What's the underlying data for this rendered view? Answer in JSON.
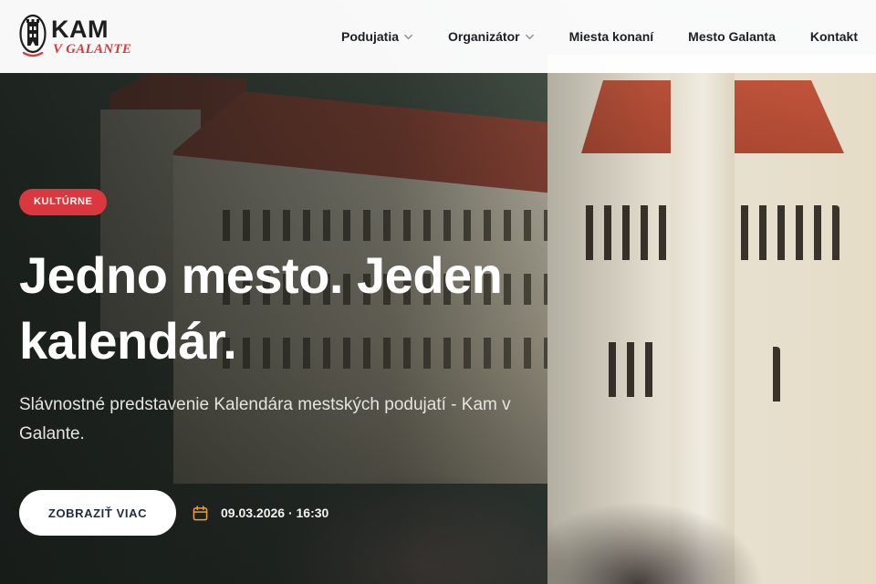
{
  "brand": {
    "name": "KAM",
    "tagline": "V GALANTE",
    "accent_color": "#d83a3d",
    "icon": "castle-tower-logo-icon"
  },
  "nav": {
    "items": [
      {
        "label": "Podujatia",
        "has_dropdown": true
      },
      {
        "label": "Organizátor",
        "has_dropdown": true
      },
      {
        "label": "Miesta konaní",
        "has_dropdown": false
      },
      {
        "label": "Mesto Galanta",
        "has_dropdown": false
      },
      {
        "label": "Kontakt",
        "has_dropdown": false
      }
    ]
  },
  "hero": {
    "badge": "KULTÚRNE",
    "badge_color": "#d9383e",
    "title_line1": "Jedno mesto. Jeden",
    "title_line2": "kalendár.",
    "subtitle": "Slávnostné predstavenie Kalendára mestských podujatí - Kam v Galante.",
    "cta_label": "ZOBRAZIŤ VIAC",
    "date": "09.03.2026 · 16:30",
    "date_icon": "calendar-icon",
    "date_icon_color": "#e8a13a"
  }
}
